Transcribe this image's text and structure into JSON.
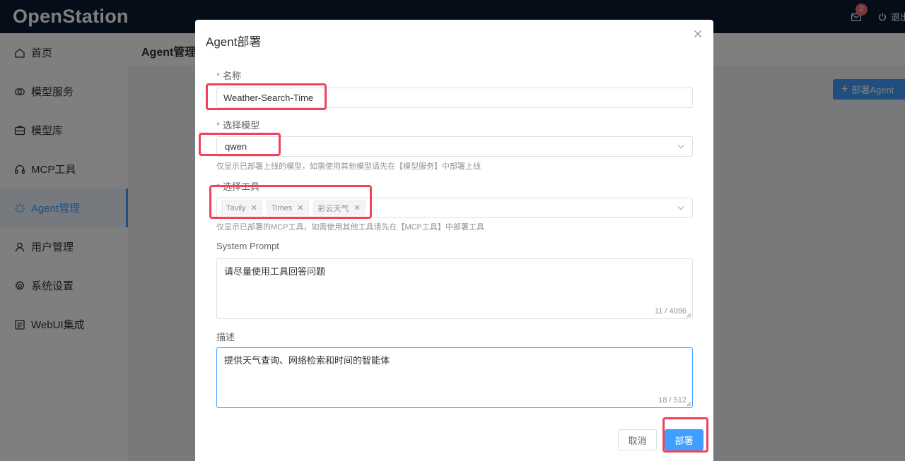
{
  "app": {
    "brand": "OpenStation"
  },
  "topbar": {
    "notification_count": "2",
    "logout_label": "退出"
  },
  "sidebar": {
    "items": [
      {
        "label": "首页",
        "icon": "home-icon"
      },
      {
        "label": "模型服务",
        "icon": "model-service-icon"
      },
      {
        "label": "模型库",
        "icon": "model-library-icon"
      },
      {
        "label": "MCP工具",
        "icon": "headset-icon"
      },
      {
        "label": "Agent管理",
        "icon": "sparkle-icon",
        "active": true
      },
      {
        "label": "用户管理",
        "icon": "user-icon"
      },
      {
        "label": "系统设置",
        "icon": "gear-icon"
      },
      {
        "label": "WebUI集成",
        "icon": "webui-icon"
      }
    ]
  },
  "page": {
    "title": "Agent管理",
    "deploy_agent_label": "部署Agent"
  },
  "dialog": {
    "title": "Agent部署",
    "name": {
      "label": "名称",
      "value": "Weather-Search-Time"
    },
    "model": {
      "label": "选择模型",
      "value": "qwen",
      "hint": "仅显示已部署上线的模型，如需使用其他模型请先在【模型服务】中部署上线"
    },
    "tools": {
      "label": "选择工具",
      "tags": [
        "Tavily",
        "Times",
        "彩云天气"
      ],
      "hint": "仅显示已部署的MCP工具，如需使用其他工具请先在【MCP工具】中部署工具"
    },
    "system_prompt": {
      "label": "System Prompt",
      "value": "请尽量使用工具回答问题",
      "counter": "11 / 4096"
    },
    "description": {
      "label": "描述",
      "value": "提供天气查询、网络检索和时间的智能体",
      "counter": "18 / 512"
    },
    "cancel_label": "取消",
    "deploy_label": "部署"
  },
  "colors": {
    "primary": "#409eff",
    "topbar": "#0b1a33",
    "highlight": "#f0435a",
    "required": "#f56c6c"
  }
}
